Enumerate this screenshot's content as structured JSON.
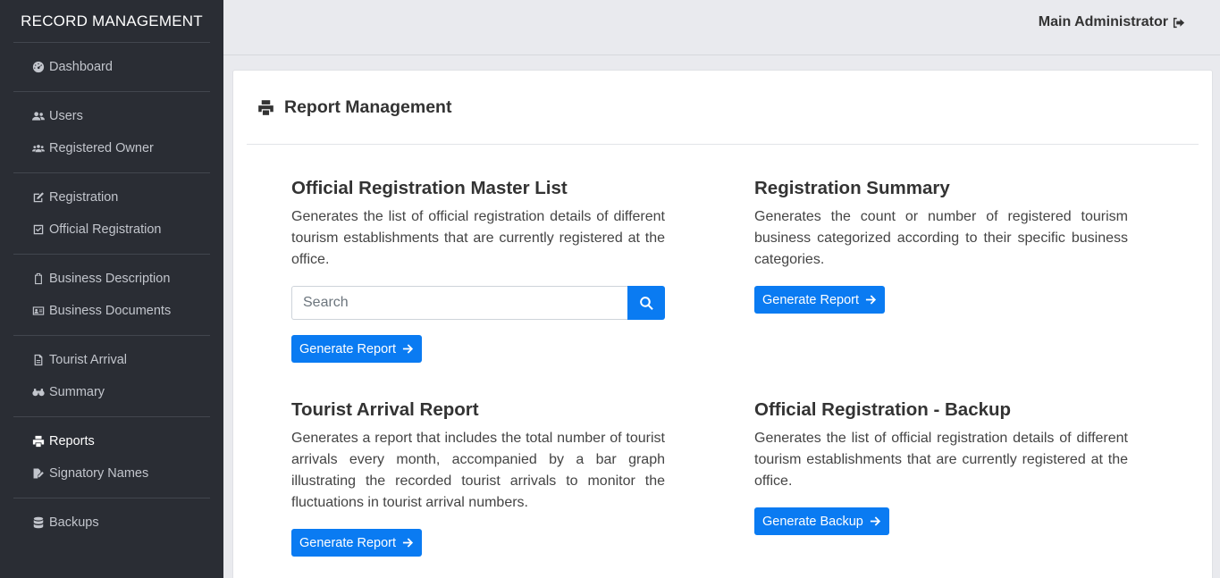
{
  "sidebar": {
    "brand": "RECORD MANAGEMENT",
    "groups": [
      [
        {
          "label": "Dashboard",
          "icon": "dashboard-icon"
        }
      ],
      [
        {
          "label": "Users",
          "icon": "users-icon"
        },
        {
          "label": "Registered Owner",
          "icon": "people-group-icon"
        }
      ],
      [
        {
          "label": "Registration",
          "icon": "edit-icon"
        },
        {
          "label": "Official Registration",
          "icon": "check-square-icon"
        }
      ],
      [
        {
          "label": "Business Description",
          "icon": "clipboard-icon"
        },
        {
          "label": "Business Documents",
          "icon": "id-card-icon"
        }
      ],
      [
        {
          "label": "Tourist Arrival",
          "icon": "file-icon"
        },
        {
          "label": "Summary",
          "icon": "binoculars-icon"
        }
      ],
      [
        {
          "label": "Reports",
          "icon": "print-icon",
          "active": true
        },
        {
          "label": "Signatory Names",
          "icon": "file-signature-icon"
        }
      ],
      [
        {
          "label": "Backups",
          "icon": "database-icon"
        }
      ]
    ]
  },
  "topbar": {
    "user": "Main Administrator",
    "logout_icon": "sign-out-icon"
  },
  "main": {
    "title": "Report Management",
    "sections": {
      "master": {
        "title": "Official Registration Master List",
        "description": "Generates the list of official registration details of different tourism establishments that are currently registered at the office.",
        "search_placeholder": "Search",
        "button": "Generate Report"
      },
      "summary": {
        "title": "Registration Summary",
        "description": "Generates the count or number of registered tourism business categorized according to their specific business categories.",
        "button": "Generate Report"
      },
      "arrival": {
        "title": "Tourist Arrival Report",
        "description": "Generates a report that includes the total number of tourist arrivals every month, accompanied by a bar graph illustrating the recorded tourist arrivals to monitor the fluctuations in tourist arrival numbers.",
        "button": "Generate Report"
      },
      "backup": {
        "title": "Official Registration - Backup",
        "description": "Generates the list of official registration details of different tourism establishments that are currently registered at the office.",
        "button": "Generate Backup"
      }
    }
  },
  "colors": {
    "accent": "#0a7bf2",
    "sidebar": "#2a2d34"
  }
}
